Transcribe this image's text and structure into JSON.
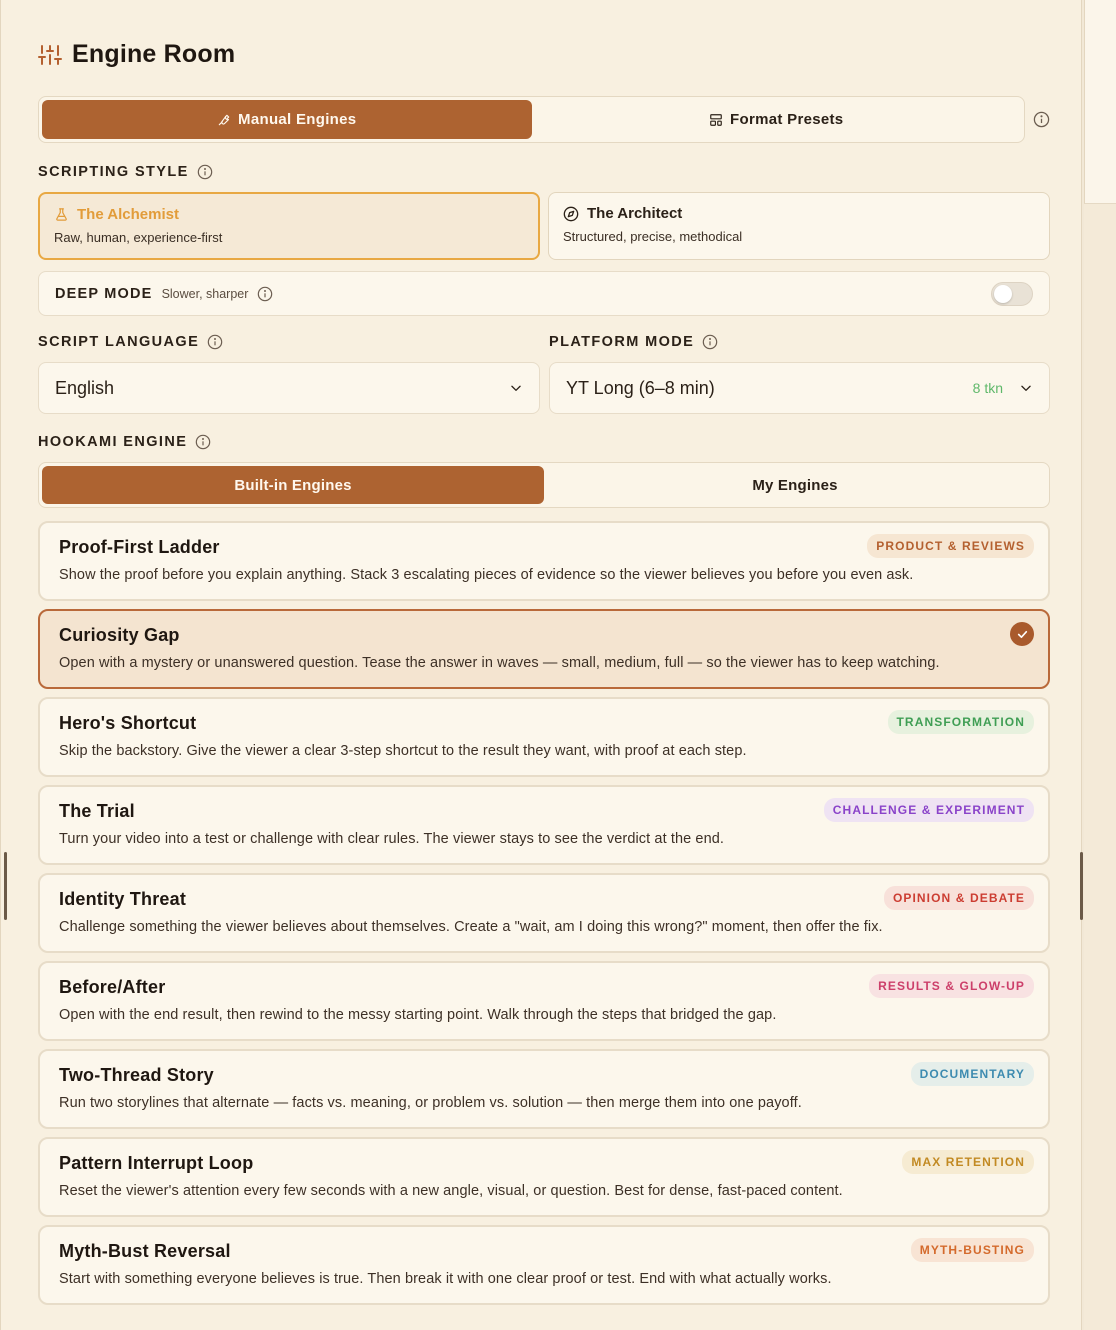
{
  "header": {
    "title": "Engine Room",
    "icon": "sliders-icon"
  },
  "mode_tabs": [
    {
      "label": "Manual Engines",
      "icon": "wrench-icon",
      "active": true
    },
    {
      "label": "Format Presets",
      "icon": "template-icon",
      "active": false
    }
  ],
  "scripting_style": {
    "label": "SCRIPTING STYLE",
    "options": [
      {
        "name": "The Alchemist",
        "desc": "Raw, human, experience-first",
        "icon": "flask-icon",
        "active": true
      },
      {
        "name": "The Architect",
        "desc": "Structured, precise, methodical",
        "icon": "compass-icon",
        "active": false
      }
    ]
  },
  "deep_mode": {
    "label": "DEEP MODE",
    "sub": "Slower, sharper",
    "enabled": false
  },
  "script_language": {
    "label": "SCRIPT LANGUAGE",
    "value": "English"
  },
  "platform_mode": {
    "label": "PLATFORM MODE",
    "value": "YT Long (6–8 min)",
    "tokens": "8 tkn"
  },
  "hookami": {
    "label": "HOOKAMI ENGINE",
    "tabs": [
      {
        "label": "Built-in Engines",
        "active": true
      },
      {
        "label": "My Engines",
        "active": false
      }
    ],
    "engines": [
      {
        "name": "Proof-First Ladder",
        "desc": "Show the proof before you explain anything. Stack 3 escalating pieces of evidence so the viewer believes you before you even ask.",
        "tag": "PRODUCT & REVIEWS",
        "tag_color": "#b4602f",
        "tag_bg": "#f6e6d2",
        "selected": false
      },
      {
        "name": "Curiosity Gap",
        "desc": "Open with a mystery or unanswered question. Tease the answer in waves — small, medium, full — so the viewer has to keep watching.",
        "tag": "",
        "selected": true
      },
      {
        "name": "Hero's Shortcut",
        "desc": "Skip the backstory. Give the viewer a clear 3-step shortcut to the result they want, with proof at each step.",
        "tag": "TRANSFORMATION",
        "tag_color": "#3f9e54",
        "tag_bg": "#e7f1de",
        "selected": false
      },
      {
        "name": "The Trial",
        "desc": "Turn your video into a test or challenge with clear rules. The viewer stays to see the verdict at the end.",
        "tag": "CHALLENGE & EXPERIMENT",
        "tag_color": "#8a43c9",
        "tag_bg": "#efe3f3",
        "selected": false
      },
      {
        "name": "Identity Threat",
        "desc": "Challenge something the viewer believes about themselves. Create a \"wait, am I doing this wrong?\" moment, then offer the fix.",
        "tag": "OPINION & DEBATE",
        "tag_color": "#cc3d32",
        "tag_bg": "#f8e1da",
        "selected": false
      },
      {
        "name": "Before/After",
        "desc": "Open with the end result, then rewind to the messy starting point. Walk through the steps that bridged the gap.",
        "tag": "RESULTS & GLOW-UP",
        "tag_color": "#cc3f6a",
        "tag_bg": "#f8e2e2",
        "selected": false
      },
      {
        "name": "Two-Thread Story",
        "desc": "Run two storylines that alternate — facts vs. meaning, or problem vs. solution — then merge them into one payoff.",
        "tag": "DOCUMENTARY",
        "tag_color": "#3d8bb0",
        "tag_bg": "#e5eeea",
        "selected": false
      },
      {
        "name": "Pattern Interrupt Loop",
        "desc": "Reset the viewer's attention every few seconds with a new angle, visual, or question. Best for dense, fast-paced content.",
        "tag": "MAX RETENTION",
        "tag_color": "#c28a23",
        "tag_bg": "#f6ebd2",
        "selected": false
      },
      {
        "name": "Myth-Bust Reversal",
        "desc": "Start with something everyone believes is true. Then break it with one clear proof or test. End with what actually works.",
        "tag": "MYTH-BUSTING",
        "tag_color": "#d46a2c",
        "tag_bg": "#f8e4d4",
        "selected": false
      }
    ]
  }
}
